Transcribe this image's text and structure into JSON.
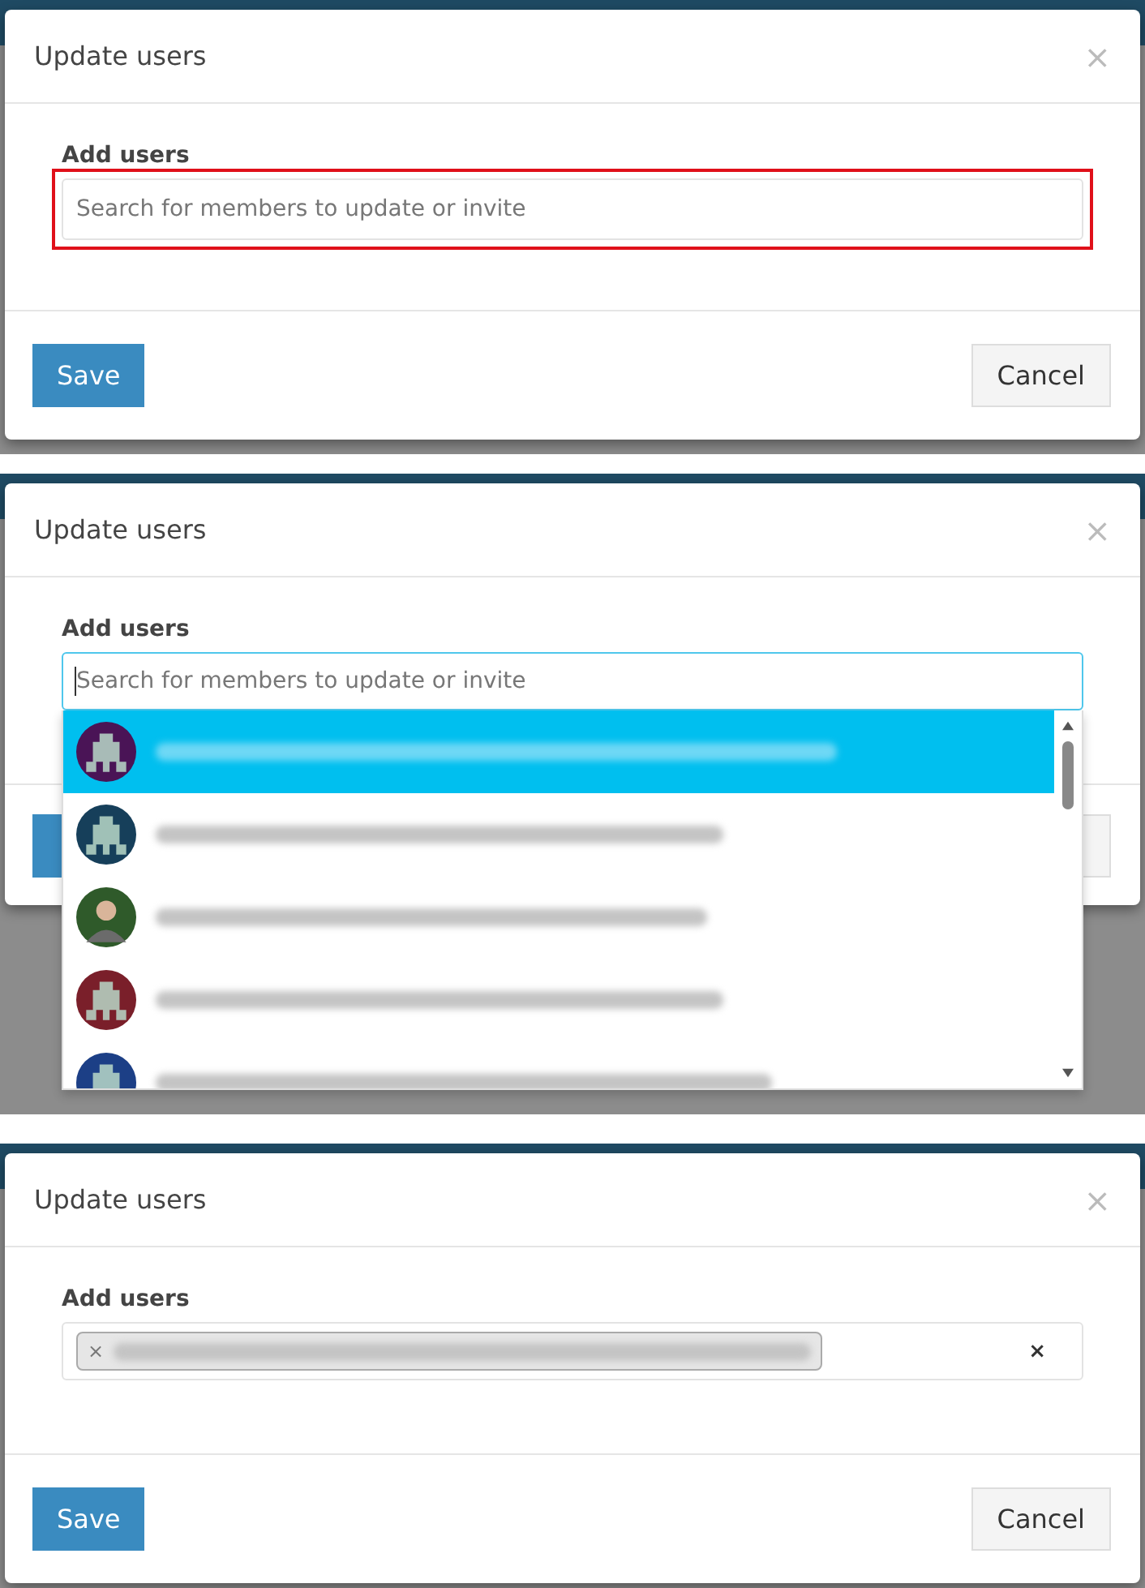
{
  "panels": [
    {
      "kind": "empty",
      "title": "Update users",
      "close": "×",
      "label": "Add users",
      "placeholder": "Search for members to update or invite",
      "highlighted": true,
      "buttons": {
        "save": "Save",
        "cancel": "Cancel"
      }
    },
    {
      "kind": "dropdown",
      "title": "Update users",
      "close": "×",
      "label": "Add users",
      "placeholder": "Search for members to update or invite",
      "focused": true,
      "options": [
        {
          "selected": true,
          "kind": "identicon",
          "color": "#4a1456"
        },
        {
          "selected": false,
          "kind": "identicon",
          "color": "#163f5a"
        },
        {
          "selected": false,
          "kind": "photo",
          "color": "#2f5a2a"
        },
        {
          "selected": false,
          "kind": "identicon",
          "color": "#7a1f2a"
        },
        {
          "selected": false,
          "kind": "identicon",
          "color": "#1c3f86"
        }
      ]
    },
    {
      "kind": "chosen",
      "title": "Update users",
      "close": "×",
      "label": "Add users",
      "chips": [
        {
          "remove": "×"
        }
      ],
      "clear": "×",
      "buttons": {
        "save": "Save",
        "cancel": "Cancel"
      }
    }
  ]
}
